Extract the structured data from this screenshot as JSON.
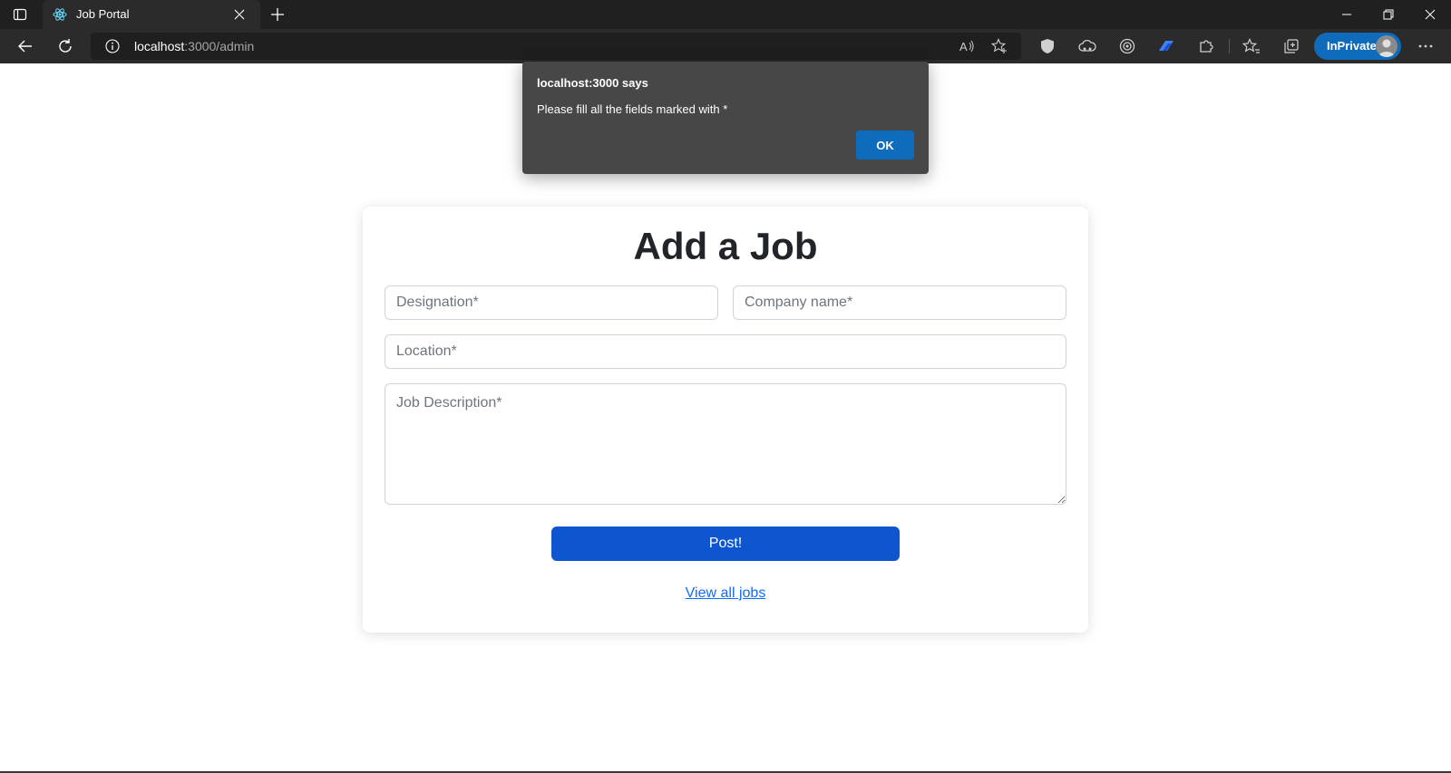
{
  "browser": {
    "tab_title": "Job Portal",
    "url_host": "localhost",
    "url_path": ":3000/admin",
    "inprivate_label": "InPrivate"
  },
  "dialog": {
    "title": "localhost:3000 says",
    "message": "Please fill all the fields marked with *",
    "ok_label": "OK"
  },
  "form": {
    "heading": "Add a Job",
    "designation_placeholder": "Designation*",
    "company_placeholder": "Company name*",
    "location_placeholder": "Location*",
    "description_placeholder": "Job Description*",
    "submit_label": "Post!",
    "view_all_label": "View all jobs"
  },
  "colors": {
    "submit_button": "#0d56d0",
    "link": "#0d6efd",
    "dialog_background": "#474747",
    "dialog_ok": "#0f6cbd"
  }
}
